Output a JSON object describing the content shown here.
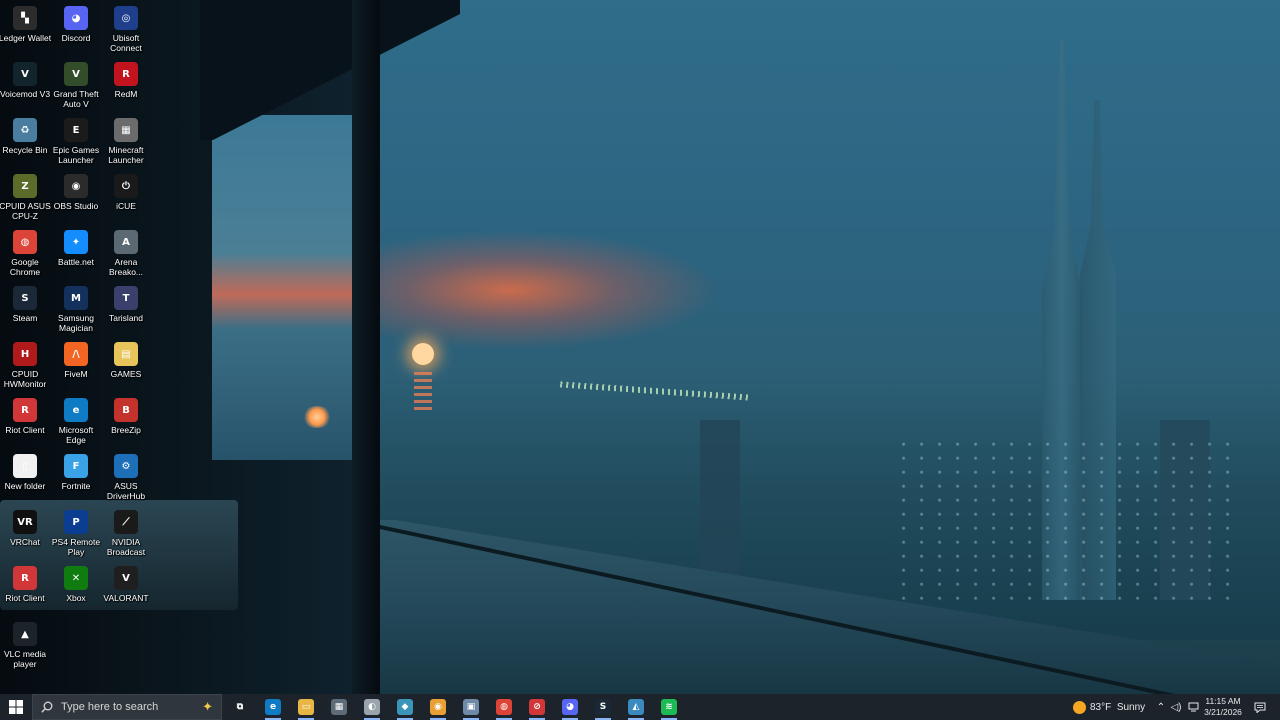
{
  "desktop": {
    "icons": [
      {
        "label": "Ledger Wallet",
        "icon": "ledger-wallet-icon",
        "color": "#2c2c2c",
        "glyph": "▚"
      },
      {
        "label": "Discord",
        "icon": "discord-icon",
        "color": "#5865f2",
        "glyph": "◕"
      },
      {
        "label": "Ubisoft Connect",
        "icon": "ubisoft-icon",
        "color": "#1f3e8c",
        "glyph": "◎"
      },
      {
        "label": "Voicemod V3",
        "icon": "voicemod-icon",
        "color": "#12242c",
        "glyph": "V"
      },
      {
        "label": "Grand Theft Auto V",
        "icon": "gta-icon",
        "color": "#334d2a",
        "glyph": "V"
      },
      {
        "label": "RedM",
        "icon": "redm-icon",
        "color": "#c2141e",
        "glyph": "R"
      },
      {
        "label": "Recycle Bin",
        "icon": "recycle-bin-icon",
        "color": "#4a7ea0",
        "glyph": "♻"
      },
      {
        "label": "Epic Games Launcher",
        "icon": "epic-games-icon",
        "color": "#1b1b1b",
        "glyph": "E"
      },
      {
        "label": "Minecraft Launcher",
        "icon": "minecraft-icon",
        "color": "#6b6b6b",
        "glyph": "▦"
      },
      {
        "label": "CPUID ASUS CPU-Z",
        "icon": "cpu-z-icon",
        "color": "#5a6b2a",
        "glyph": "Z"
      },
      {
        "label": "OBS Studio",
        "icon": "obs-icon",
        "color": "#2b2b2b",
        "glyph": "◉"
      },
      {
        "label": "iCUE",
        "icon": "icue-icon",
        "color": "#1a1a1a",
        "glyph": "⏻"
      },
      {
        "label": "Google Chrome",
        "icon": "chrome-icon",
        "color": "#db4437",
        "glyph": "◍"
      },
      {
        "label": "Battle.net",
        "icon": "battlenet-icon",
        "color": "#148eff",
        "glyph": "✦"
      },
      {
        "label": "Arena Breako...",
        "icon": "arena-breakout-icon",
        "color": "#5b6a72",
        "glyph": "A"
      },
      {
        "label": "Steam",
        "icon": "steam-icon",
        "color": "#1b2838",
        "glyph": "S"
      },
      {
        "label": "Samsung Magician",
        "icon": "samsung-magician-icon",
        "color": "#14315e",
        "glyph": "M"
      },
      {
        "label": "Tarisland",
        "icon": "tarisland-icon",
        "color": "#3a3f6b",
        "glyph": "T"
      },
      {
        "label": "CPUID HWMonitor",
        "icon": "hwmonitor-icon",
        "color": "#b11a1a",
        "glyph": "H"
      },
      {
        "label": "FiveM",
        "icon": "fivem-icon",
        "color": "#f26522",
        "glyph": "/\\"
      },
      {
        "label": "GAMES",
        "icon": "folder-games-icon",
        "color": "#e8c55a",
        "glyph": "▤"
      },
      {
        "label": "Riot Client",
        "icon": "riot-client-icon",
        "color": "#d13639",
        "glyph": "R"
      },
      {
        "label": "Microsoft Edge",
        "icon": "edge-icon",
        "color": "#0f7bc4",
        "glyph": "e"
      },
      {
        "label": "BreeZip",
        "icon": "breezip-icon",
        "color": "#c4332b",
        "glyph": "B"
      },
      {
        "label": "New folder",
        "icon": "new-folder-icon",
        "color": "#f1f1f1",
        "glyph": "▯"
      },
      {
        "label": "Fortnite",
        "icon": "fortnite-icon",
        "color": "#3aa3e8",
        "glyph": "F"
      },
      {
        "label": "ASUS DriverHub",
        "icon": "asus-driverhub-icon",
        "color": "#1d6fb8",
        "glyph": "⚙"
      },
      {
        "label": "VRChat",
        "icon": "vrchat-icon",
        "color": "#101010",
        "glyph": "VR"
      },
      {
        "label": "PS4 Remote Play",
        "icon": "ps4-remote-play-icon",
        "color": "#0b3d91",
        "glyph": "P"
      },
      {
        "label": "NVIDIA Broadcast",
        "icon": "nvidia-broadcast-icon",
        "color": "#1a1a1a",
        "glyph": "⟋"
      },
      {
        "label": "Riot Client",
        "icon": "riot-client-icon",
        "color": "#d13639",
        "glyph": "R"
      },
      {
        "label": "Xbox",
        "icon": "xbox-icon",
        "color": "#107c10",
        "glyph": "✕"
      },
      {
        "label": "VALORANT",
        "icon": "valorant-icon",
        "color": "#1f1f1f",
        "glyph": "V"
      },
      {
        "label": "VLC media player",
        "icon": "vlc-icon",
        "color": "#1c232b",
        "glyph": "▲"
      }
    ]
  },
  "taskbar": {
    "start_icon": "windows-start-icon",
    "search": {
      "placeholder": "Type here to search"
    },
    "apps": [
      {
        "name": "task-view-icon",
        "color": "#1c232b",
        "glyph": "⧉"
      },
      {
        "name": "edge-icon",
        "color": "#0f7bc4",
        "glyph": "e"
      },
      {
        "name": "file-explorer-icon",
        "color": "#e8b645",
        "glyph": "▭"
      },
      {
        "name": "calculator-icon",
        "color": "#5d6b78",
        "glyph": "▦"
      },
      {
        "name": "app-icon-1",
        "color": "#9aa4ad",
        "glyph": "◐"
      },
      {
        "name": "app-icon-2",
        "color": "#3a95b8",
        "glyph": "◆"
      },
      {
        "name": "app-icon-3",
        "color": "#e8a035",
        "glyph": "◉"
      },
      {
        "name": "app-icon-4",
        "color": "#6f8aa8",
        "glyph": "▣"
      },
      {
        "name": "chrome-icon",
        "color": "#db4437",
        "glyph": "◍"
      },
      {
        "name": "app-icon-5",
        "color": "#d13639",
        "glyph": "⊘"
      },
      {
        "name": "discord-icon",
        "color": "#5865f2",
        "glyph": "◕"
      },
      {
        "name": "steam-icon",
        "color": "#1b2838",
        "glyph": "S"
      },
      {
        "name": "app-icon-6",
        "color": "#3a8ac0",
        "glyph": "◭"
      },
      {
        "name": "spotify-icon",
        "color": "#1db954",
        "glyph": "≋"
      }
    ],
    "weather": {
      "temp": "83°F",
      "condition": "Sunny"
    },
    "clock": {
      "time": "11:15 AM",
      "date": "3/21/2026"
    },
    "accent_color": "#8ab4f8"
  }
}
